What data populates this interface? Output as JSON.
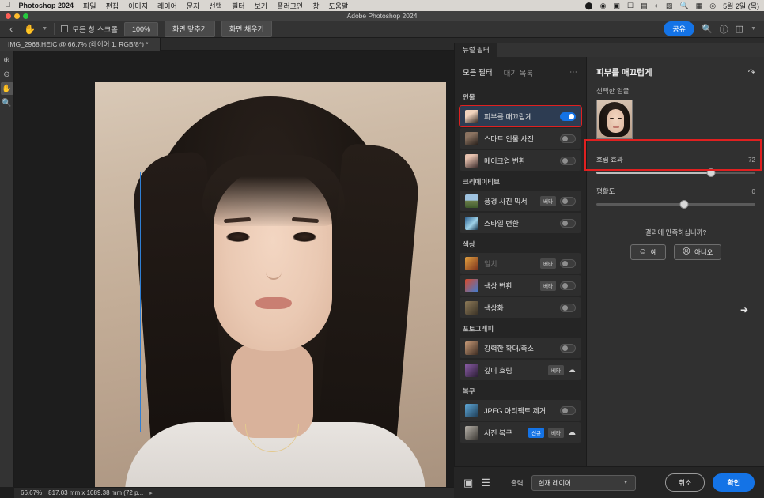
{
  "mac_menu": {
    "app_name": "Photoshop 2024",
    "items": [
      "파일",
      "편집",
      "이미지",
      "레이어",
      "문자",
      "선택",
      "필터",
      "보기",
      "플러그인",
      "창",
      "도움말"
    ],
    "status_icons": [
      "record-icon",
      "screenshot-icon",
      "control-center-icon",
      "display-icon",
      "battery-icon",
      "wifi-icon",
      "input-source-icon",
      "spotlight-search-icon",
      "screen-mirroring-icon",
      "siri-icon"
    ],
    "clock": "5월 2일 (목)"
  },
  "window": {
    "title": "Adobe Photoshop 2024"
  },
  "options_bar": {
    "back_icon": "chevron-left-icon",
    "tool_icon": "hand-tool-icon",
    "checkbox_label": "모든 창 스크롤",
    "zoom_value": "100%",
    "fit_screen": "화면 맞추기",
    "fill_screen": "화면 채우기",
    "share_label": "공유",
    "right_icons": [
      "search-icon",
      "help-icon",
      "workspace-icon"
    ]
  },
  "document": {
    "tab_title": "IMG_2968.HEIC @ 66.7% (레이어 1, RGB/8*) *"
  },
  "toolbar": {
    "tools": [
      "zoom-in-icon",
      "zoom-out-icon",
      "hand-tool-icon",
      "magnifier-icon"
    ],
    "active_index": 2
  },
  "status_bar": {
    "zoom": "66.67%",
    "dimensions": "817.03 mm x 1089.38 mm (72 p...",
    "caret": "chevron-right-icon"
  },
  "neural_filters": {
    "panel_tab": "뉴럴 필터",
    "subtabs": [
      {
        "label": "모든 필터",
        "active": true
      },
      {
        "label": "대기 목록",
        "active": false
      }
    ],
    "overflow_icon": "more-options-icon",
    "groups": [
      {
        "title": "인물",
        "items": [
          {
            "label": "피부를 매끄럽게",
            "thumb": "t-skin",
            "toggle": "on",
            "selected": true,
            "highlight": true,
            "badges": []
          },
          {
            "label": "스마트 인물 사진",
            "thumb": "t-smart",
            "toggle": "off",
            "selected": false,
            "highlight": false,
            "badges": []
          },
          {
            "label": "메이크업 변환",
            "thumb": "t-makeup",
            "toggle": "off",
            "selected": false,
            "highlight": false,
            "badges": []
          }
        ]
      },
      {
        "title": "크리에이티브",
        "items": [
          {
            "label": "풍경 사진 믹서",
            "thumb": "t-landscape",
            "toggle": "off",
            "selected": false,
            "highlight": false,
            "badges": [
              "베타"
            ]
          },
          {
            "label": "스타일 변환",
            "thumb": "t-style",
            "toggle": "off",
            "selected": false,
            "highlight": false,
            "badges": []
          }
        ]
      },
      {
        "title": "색상",
        "items": [
          {
            "label": "일치",
            "thumb": "t-match",
            "toggle": "off",
            "selected": false,
            "highlight": false,
            "disabled": true,
            "badges": [
              "베타"
            ]
          },
          {
            "label": "색상 변환",
            "thumb": "t-colortrans",
            "toggle": "off",
            "selected": false,
            "highlight": false,
            "badges": [
              "베타"
            ]
          },
          {
            "label": "색상화",
            "thumb": "t-colorize",
            "toggle": "off",
            "selected": false,
            "highlight": false,
            "badges": []
          }
        ]
      },
      {
        "title": "포토그래피",
        "items": [
          {
            "label": "강력한 확대/축소",
            "thumb": "t-zoom",
            "toggle": "off",
            "selected": false,
            "highlight": false,
            "badges": []
          },
          {
            "label": "깊이 흐림",
            "thumb": "t-depth",
            "toggle": "cloud",
            "selected": false,
            "highlight": false,
            "badges": [
              "베타"
            ]
          }
        ]
      },
      {
        "title": "복구",
        "items": [
          {
            "label": "JPEG 아티팩트 제거",
            "thumb": "t-jpeg",
            "toggle": "off",
            "selected": false,
            "highlight": false,
            "badges": []
          },
          {
            "label": "사진 복구",
            "thumb": "t-restore",
            "toggle": "cloud",
            "selected": false,
            "highlight": false,
            "badges": [
              "신규",
              "베타"
            ]
          }
        ]
      }
    ]
  },
  "settings": {
    "title": "피부를 매끄럽게",
    "reset_icon": "reset-icon",
    "face_label": "선택한 얼굴",
    "face_thumb": "selected-face-thumbnail",
    "sliders": [
      {
        "name": "흐림 효과",
        "value": "72",
        "percent": 72,
        "highlight": true
      },
      {
        "name": "평활도",
        "value": "0",
        "percent": 55,
        "highlight": false
      }
    ],
    "feedback": {
      "question": "결과에 만족하십니까?",
      "yes_label": "예",
      "yes_icon": "smiley-happy-icon",
      "no_label": "아니오",
      "no_icon": "smiley-sad-icon"
    }
  },
  "footer": {
    "preview_icon": "split-preview-icon",
    "layers_icon": "layers-icon",
    "output_label": "출력",
    "output_value": "현재 레이어",
    "output_caret": "chevron-down-icon",
    "cancel_label": "취소",
    "ok_label": "확인"
  },
  "colors": {
    "accent_blue": "#1473e6",
    "highlight_red": "#e02020",
    "selection_blue": "#2f7fd4",
    "panel_bg": "#252525",
    "settings_bg": "#303030"
  }
}
